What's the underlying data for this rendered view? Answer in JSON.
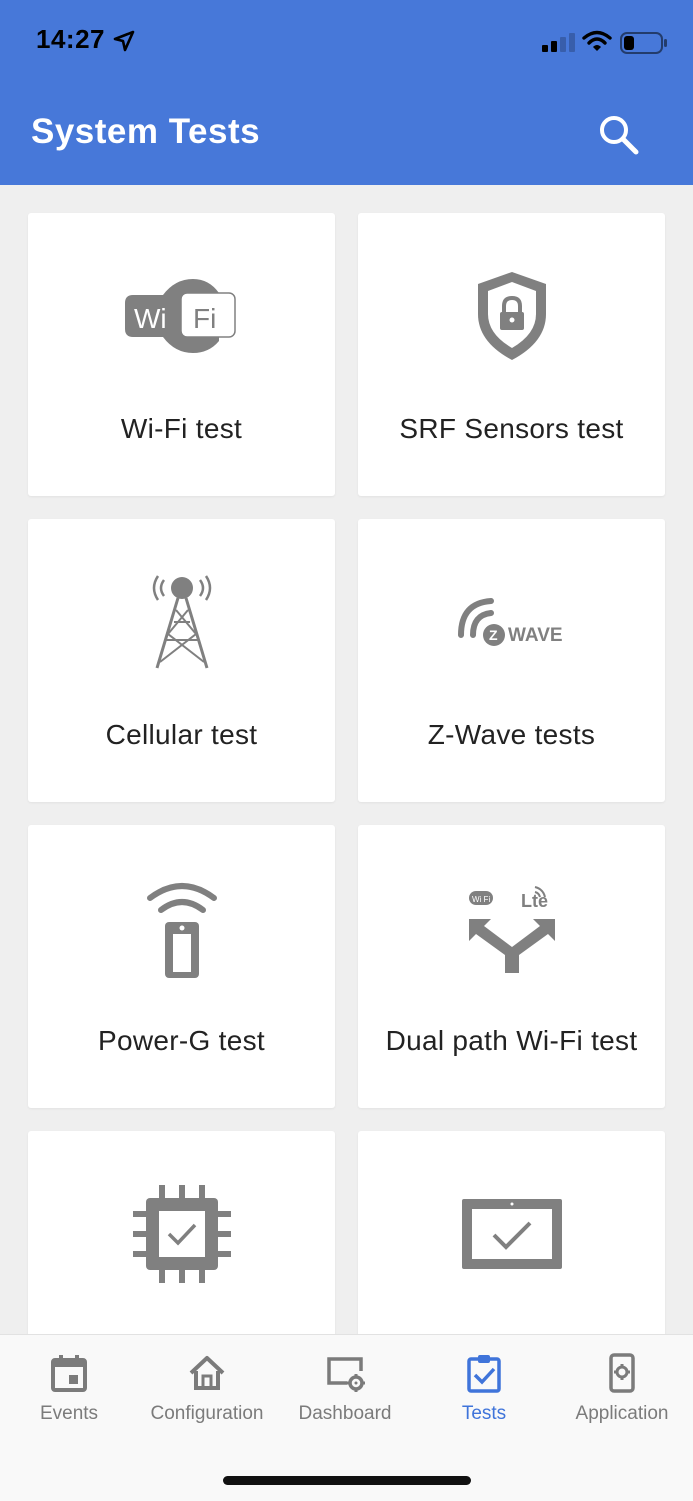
{
  "status_bar": {
    "time": "14:27"
  },
  "header": {
    "title": "System Tests"
  },
  "tests": [
    {
      "label": "Wi-Fi test",
      "icon": "wifi-logo-icon"
    },
    {
      "label": "SRF Sensors test",
      "icon": "shield-lock-icon"
    },
    {
      "label": "Cellular test",
      "icon": "cell-tower-icon"
    },
    {
      "label": "Z-Wave tests",
      "icon": "zwave-logo-icon",
      "icon_text": "WAVE"
    },
    {
      "label": "Power-G test",
      "icon": "remote-signal-icon"
    },
    {
      "label": "Dual path Wi-Fi test",
      "icon": "dual-path-icon",
      "icon_text": "Lte"
    },
    {
      "label": "",
      "icon": "chip-check-icon"
    },
    {
      "label": "",
      "icon": "display-check-icon"
    }
  ],
  "tabs": [
    {
      "label": "Events",
      "icon": "calendar-icon",
      "active": false
    },
    {
      "label": "Configuration",
      "icon": "home-icon",
      "active": false
    },
    {
      "label": "Dashboard",
      "icon": "dashboard-gear-icon",
      "active": false
    },
    {
      "label": "Tests",
      "icon": "clipboard-check-icon",
      "active": true
    },
    {
      "label": "Application",
      "icon": "phone-gear-icon",
      "active": false
    }
  ],
  "colors": {
    "header": "#4778d9",
    "active_tab": "#3f74da",
    "icon_gray": "#808080"
  }
}
